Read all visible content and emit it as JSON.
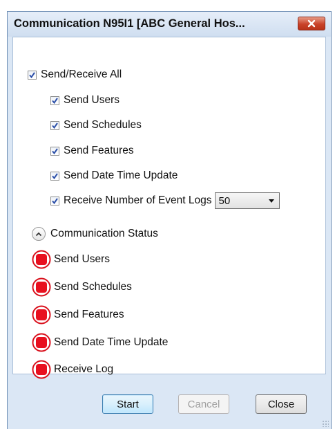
{
  "window": {
    "title": "Communication N95I1 [ABC General Hos..."
  },
  "options": {
    "send_receive_all": {
      "label": "Send/Receive All",
      "checked": true
    },
    "items": [
      {
        "label": "Send Users",
        "checked": true
      },
      {
        "label": "Send Schedules",
        "checked": true
      },
      {
        "label": "Send Features",
        "checked": true
      },
      {
        "label": "Send Date Time Update",
        "checked": true
      },
      {
        "label": "Receive Number of Event Logs",
        "checked": true
      }
    ],
    "event_logs_count": "50"
  },
  "status_section": {
    "label": "Communication Status",
    "items": [
      {
        "label": "Send Users",
        "state": "red-stop-icon"
      },
      {
        "label": "Send Schedules",
        "state": "red-stop-icon"
      },
      {
        "label": "Send Features",
        "state": "red-stop-icon"
      },
      {
        "label": "Send Date Time Update",
        "state": "red-stop-icon"
      },
      {
        "label": "Receive Log",
        "state": "red-stop-icon"
      }
    ]
  },
  "buttons": {
    "start": "Start",
    "cancel": "Cancel",
    "close": "Close"
  },
  "colors": {
    "status_red": "#e8101f",
    "check_blue": "#2b4fa8",
    "frame_blue": "#dbe7f5"
  }
}
